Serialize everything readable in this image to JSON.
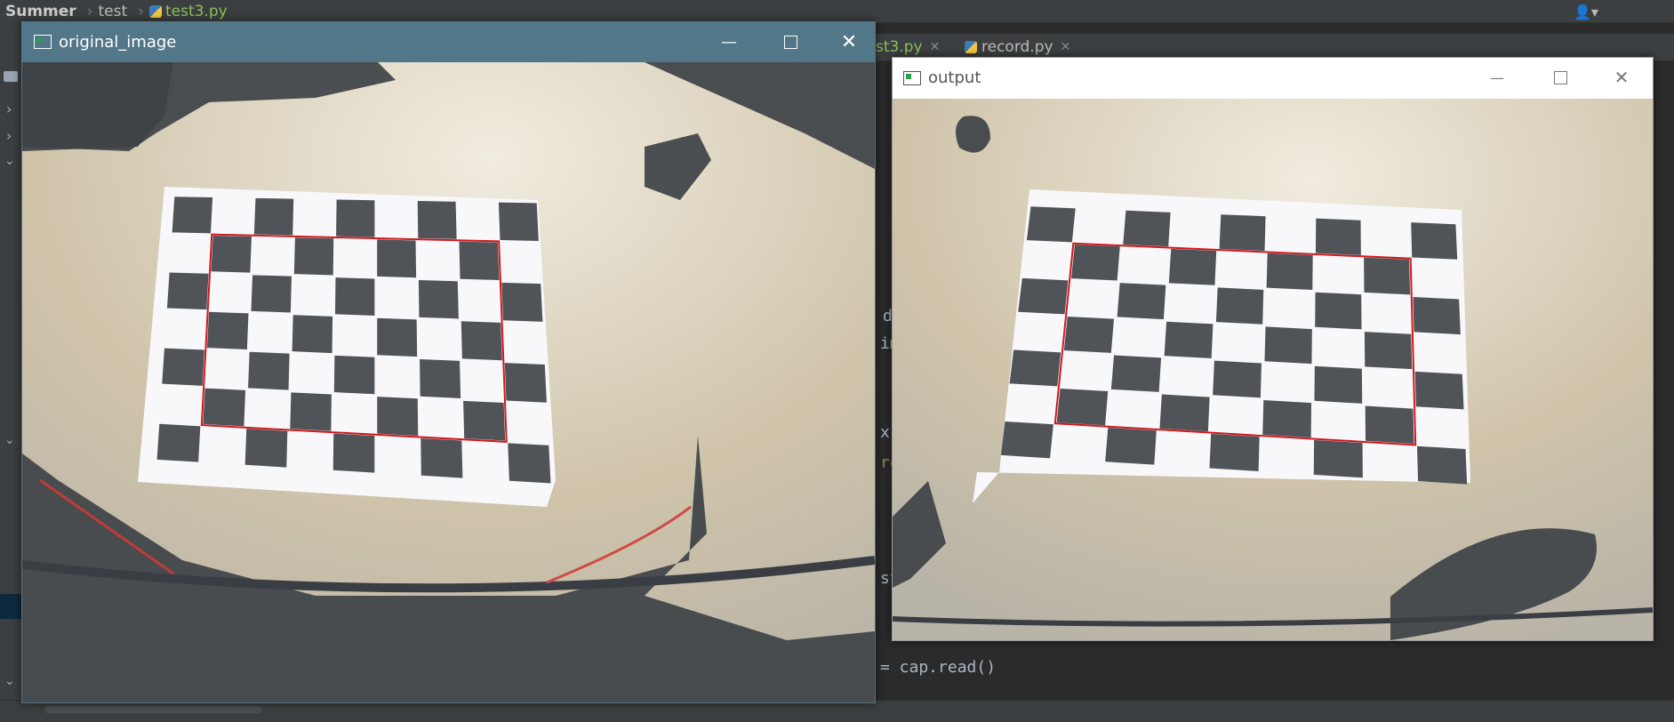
{
  "ide": {
    "breadcrumb": [
      "Summer",
      "test",
      "test3.py"
    ],
    "tabs": [
      {
        "label": "st3.py"
      },
      {
        "label": "record.py"
      }
    ],
    "code_fragments": [
      "d",
      "im",
      "x:",
      "re",
      "st",
      "= cap.read()"
    ]
  },
  "windows": {
    "original": {
      "title": "original_image",
      "controls": [
        "minimize",
        "maximize",
        "close"
      ]
    },
    "output": {
      "title": "output",
      "controls": [
        "minimize",
        "maximize",
        "close"
      ]
    }
  },
  "colors": {
    "highlight_rect": "#d0181d",
    "checker_dark": "#505458",
    "checker_paper": "#f8f8fb",
    "desk": "#cfc4aa",
    "titlebar_active": "#527789",
    "ide_bg": "#2b2b2b"
  },
  "scene": {
    "checkerboard_columns": 9,
    "checkerboard_rows": 7
  }
}
